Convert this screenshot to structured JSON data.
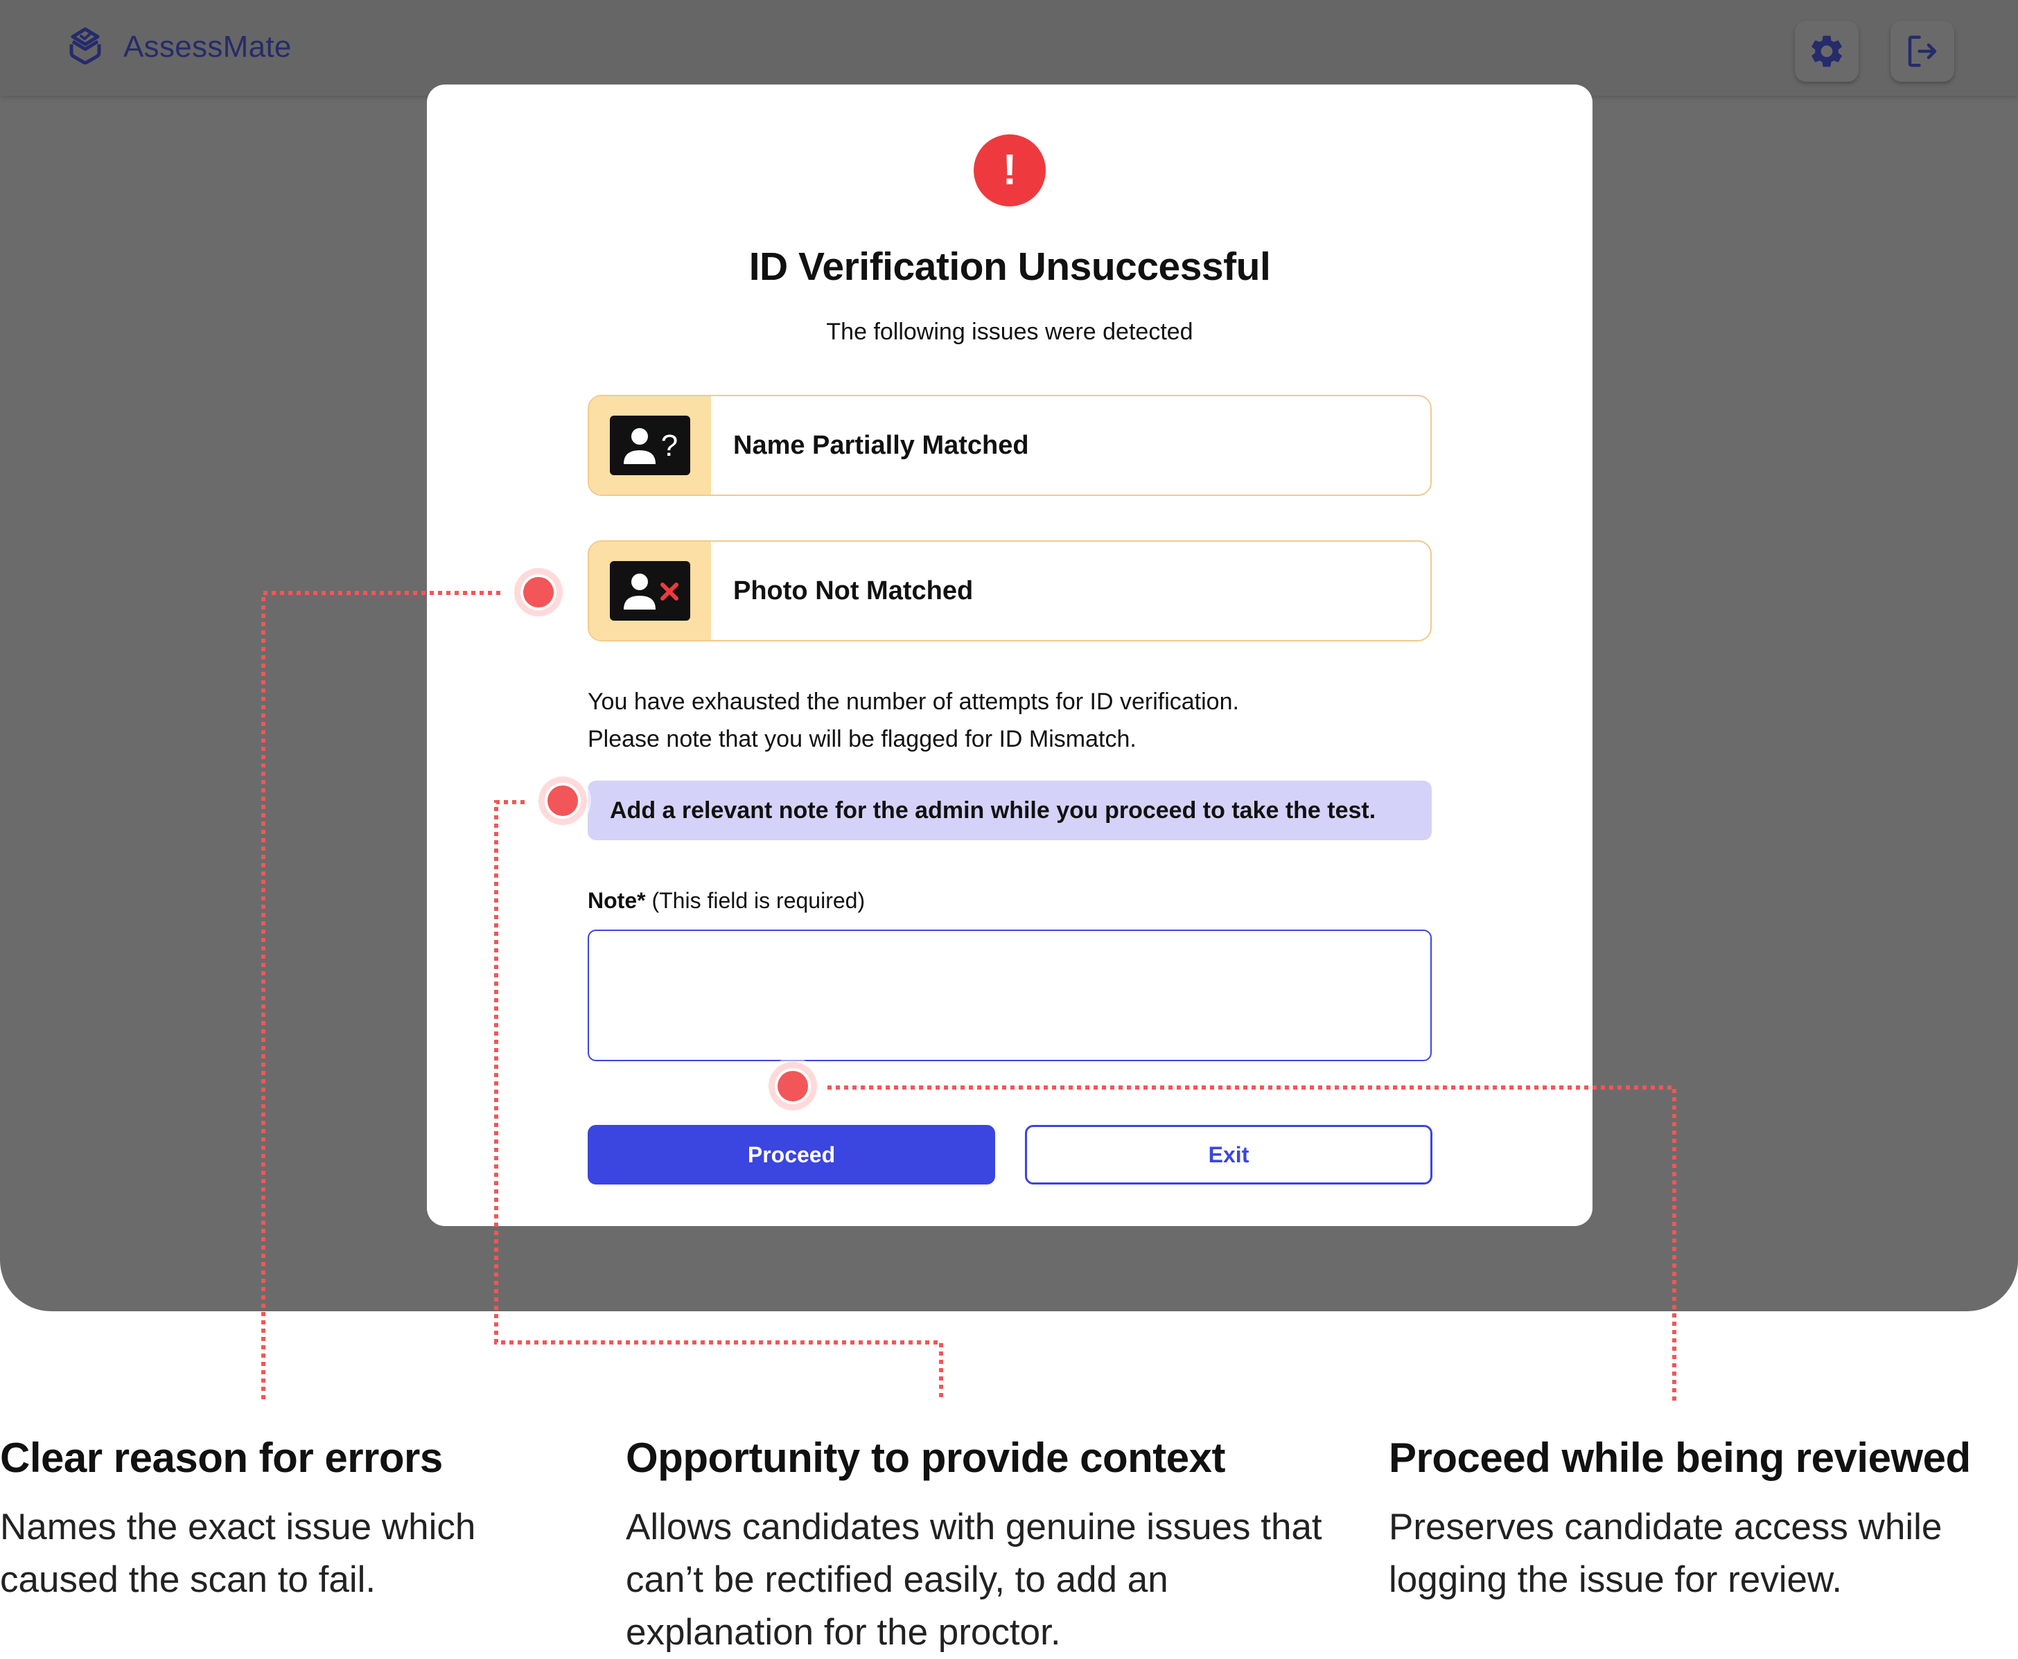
{
  "app": {
    "brand_name": "AssessMate"
  },
  "header": {
    "settings_icon": "gear-icon",
    "logout_icon": "logout-icon"
  },
  "modal": {
    "alert_icon": "exclamation-icon",
    "alert_glyph": "!",
    "title": "ID Verification Unsuccessful",
    "subtitle": "The following issues were detected",
    "issues": [
      {
        "label": "Name Partially Matched",
        "icon": "person-question-icon"
      },
      {
        "label": "Photo Not Matched",
        "icon": "person-x-icon"
      }
    ],
    "message_line1": "You have exhausted the number of attempts for ID verification.",
    "message_line2": "Please note that you will be flagged for ID Mismatch.",
    "info_banner": "Add a relevant note for the admin while you proceed to take the test.",
    "note_label": "Note*",
    "note_hint": "(This field is required)",
    "note_value": "",
    "proceed_label": "Proceed",
    "exit_label": "Exit"
  },
  "colors": {
    "primary": "#3B45DF",
    "alert": "#EE3A3E",
    "issue_bg": "#FCDFA5",
    "issue_border": "#F3C98A",
    "banner_bg": "#D4D2F8",
    "annotation": "#F25658"
  },
  "annotations": [
    {
      "title": "Clear reason for errors",
      "body": "Names the exact issue which caused the scan to fail."
    },
    {
      "title": "Opportunity to provide context",
      "body": "Allows candidates with genuine issues that can’t be rectified easily, to add an explanation for the proctor."
    },
    {
      "title": "Proceed while being reviewed",
      "body": "Preserves candidate access while logging the issue for review."
    }
  ]
}
